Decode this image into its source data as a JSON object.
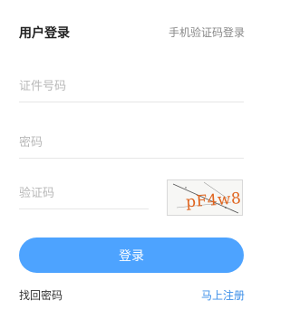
{
  "header": {
    "title": "用户登录",
    "switch_label": "手机验证码登录"
  },
  "form": {
    "id_placeholder": "证件号码",
    "password_placeholder": "密码",
    "captcha_placeholder": "验证码",
    "captcha_text": "pF4w8"
  },
  "actions": {
    "login_label": "登录",
    "forgot_label": "找回密码",
    "register_label": "马上注册"
  },
  "colors": {
    "primary_button": "#4da3ff",
    "link": "#3d8fe8",
    "captcha_text": "#e0641e"
  }
}
